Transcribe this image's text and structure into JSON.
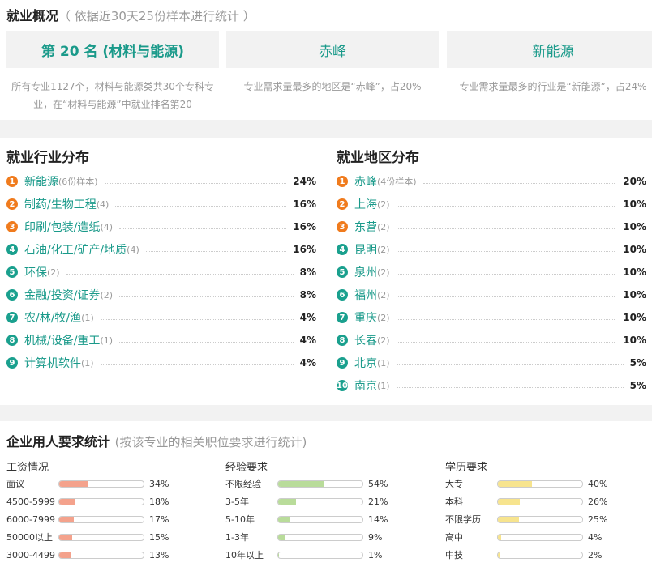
{
  "overview": {
    "title": "就业概况",
    "subtitle": "（ 依据近30天25份样本进行统计 ）",
    "cards": [
      {
        "label": "第 20 名 (材料与能源)",
        "desc": "所有专业1127个，材料与能源类共30个专科专业，在“材料与能源”中就业排名第20"
      },
      {
        "label": "赤峰",
        "desc": "专业需求量最多的地区是“赤峰”，占20%"
      },
      {
        "label": "新能源",
        "desc": "专业需求量最多的行业是“新能源”，占24%"
      }
    ]
  },
  "industry": {
    "title": "就业行业分布",
    "items": [
      {
        "rank": "1",
        "name": "新能源",
        "count": "(6份样本)",
        "pct": "24%"
      },
      {
        "rank": "2",
        "name": "制药/生物工程",
        "count": "(4)",
        "pct": "16%"
      },
      {
        "rank": "3",
        "name": "印刷/包装/造纸",
        "count": "(4)",
        "pct": "16%"
      },
      {
        "rank": "4",
        "name": "石油/化工/矿产/地质",
        "count": "(4)",
        "pct": "16%"
      },
      {
        "rank": "5",
        "name": "环保",
        "count": "(2)",
        "pct": "8%"
      },
      {
        "rank": "6",
        "name": "金融/投资/证券",
        "count": "(2)",
        "pct": "8%"
      },
      {
        "rank": "7",
        "name": "农/林/牧/渔",
        "count": "(1)",
        "pct": "4%"
      },
      {
        "rank": "8",
        "name": "机械/设备/重工",
        "count": "(1)",
        "pct": "4%"
      },
      {
        "rank": "9",
        "name": "计算机软件",
        "count": "(1)",
        "pct": "4%"
      }
    ]
  },
  "region": {
    "title": "就业地区分布",
    "items": [
      {
        "rank": "1",
        "name": "赤峰",
        "count": "(4份样本)",
        "pct": "20%"
      },
      {
        "rank": "2",
        "name": "上海",
        "count": "(2)",
        "pct": "10%"
      },
      {
        "rank": "3",
        "name": "东营",
        "count": "(2)",
        "pct": "10%"
      },
      {
        "rank": "4",
        "name": "昆明",
        "count": "(2)",
        "pct": "10%"
      },
      {
        "rank": "5",
        "name": "泉州",
        "count": "(2)",
        "pct": "10%"
      },
      {
        "rank": "6",
        "name": "福州",
        "count": "(2)",
        "pct": "10%"
      },
      {
        "rank": "7",
        "name": "重庆",
        "count": "(2)",
        "pct": "10%"
      },
      {
        "rank": "8",
        "name": "长春",
        "count": "(2)",
        "pct": "10%"
      },
      {
        "rank": "9",
        "name": "北京",
        "count": "(1)",
        "pct": "5%"
      },
      {
        "rank": "10",
        "name": "南京",
        "count": "(1)",
        "pct": "5%"
      }
    ]
  },
  "requirements": {
    "title": "企业用人要求统计",
    "subtitle": "(按该专业的相关职位要求进行统计)",
    "groups": [
      {
        "name": "工资情况",
        "color": "#f4a28c",
        "rows": [
          {
            "label": "面议",
            "pct": "34%",
            "value": 34
          },
          {
            "label": "4500-5999",
            "pct": "18%",
            "value": 18
          },
          {
            "label": "6000-7999",
            "pct": "17%",
            "value": 17
          },
          {
            "label": "50000以上",
            "pct": "15%",
            "value": 15
          },
          {
            "label": "3000-4499",
            "pct": "13%",
            "value": 13
          }
        ]
      },
      {
        "name": "经验要求",
        "color": "#b9dc9a",
        "rows": [
          {
            "label": "不限经验",
            "pct": "54%",
            "value": 54
          },
          {
            "label": "3-5年",
            "pct": "21%",
            "value": 21
          },
          {
            "label": "5-10年",
            "pct": "14%",
            "value": 14
          },
          {
            "label": "1-3年",
            "pct": "9%",
            "value": 9
          },
          {
            "label": "10年以上",
            "pct": "1%",
            "value": 1
          }
        ]
      },
      {
        "name": "学历要求",
        "color": "#f7e48e",
        "rows": [
          {
            "label": "大专",
            "pct": "40%",
            "value": 40
          },
          {
            "label": "本科",
            "pct": "26%",
            "value": 26
          },
          {
            "label": "不限学历",
            "pct": "25%",
            "value": 25
          },
          {
            "label": "高中",
            "pct": "4%",
            "value": 4
          },
          {
            "label": "中技",
            "pct": "2%",
            "value": 2
          }
        ]
      }
    ]
  }
}
